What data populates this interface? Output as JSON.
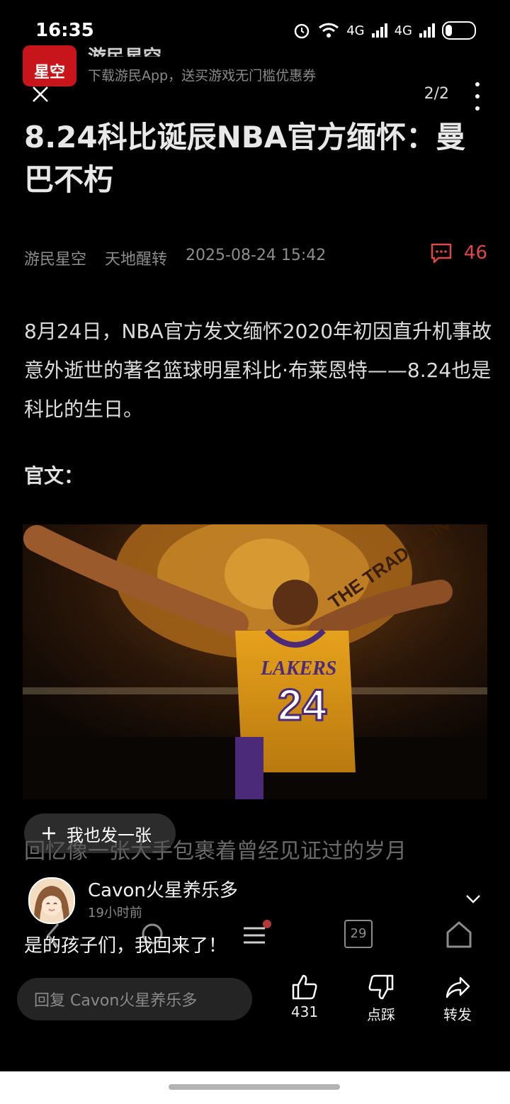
{
  "status_bar": {
    "time": "16:35",
    "network": "4G",
    "battery_level": 0.25
  },
  "ad": {
    "logo_text": "星空",
    "app_name": "游民星空",
    "text": "下载游民App，送买游戏无门槛优惠券"
  },
  "viewer": {
    "page_counter": "2/2"
  },
  "article": {
    "title": "8.24科比诞辰NBA官方缅怀：曼巴不朽",
    "source": "游民星空",
    "author": "天地醒转",
    "datetime": "2025-08-24 15:42",
    "comment_count": "46",
    "body": "8月24日，NBA官方发文缅怀2020年初因直升机事故意外逝世的著名篮球明星科比·布莱恩特——8.24也是科比的生日。",
    "subheading": "官文：",
    "photo_jersey_text": "LAKERS",
    "photo_jersey_number": "24",
    "photo_banner_text": "THE TRADITION",
    "caption": "回忆像一张大手包裹着曾经见证过的岁月"
  },
  "post_button": {
    "icon": "plus-icon",
    "label": "我也发一张"
  },
  "comment": {
    "user": "Cavon火星养乐多",
    "time": "19小时前",
    "text": "是的孩子们，我回来了！"
  },
  "nav": {
    "calendar_day": "29"
  },
  "reply": {
    "placeholder": "回复 Cavon火星养乐多"
  },
  "actions": {
    "like_count": "431",
    "dislike_label": "点踩",
    "share_label": "转发"
  },
  "colors": {
    "accent_red": "#e04848",
    "background": "#000000"
  }
}
